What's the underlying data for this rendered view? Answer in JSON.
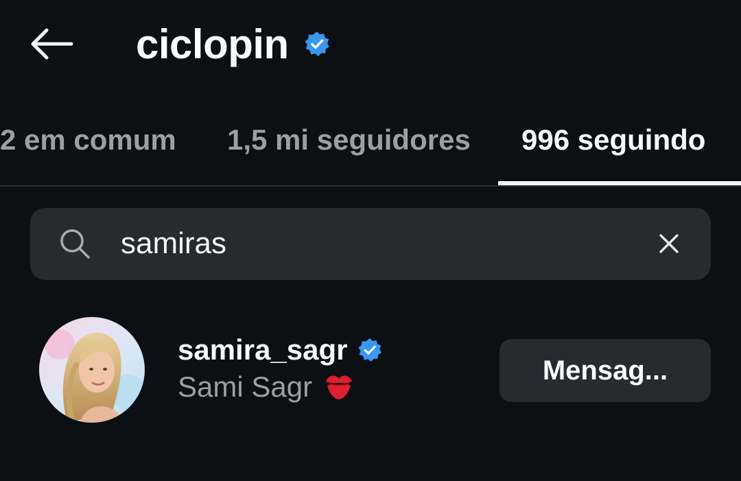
{
  "header": {
    "title": "ciclopin",
    "verified_icon": "verified-badge-icon",
    "back_icon": "arrow-left-icon"
  },
  "tabs": [
    {
      "label": "2 em comum",
      "active": false
    },
    {
      "label": "1,5 mi seguidores",
      "active": false
    },
    {
      "label": "996 seguindo",
      "active": true
    }
  ],
  "search": {
    "value": "samiras",
    "icon": "search-icon",
    "clear_icon": "close-icon"
  },
  "results": [
    {
      "username": "samira_sagr",
      "full_name": "Sami Sagr",
      "verified": true,
      "emoji": "kiss-mark-icon",
      "action_label": "Mensag..."
    }
  ],
  "colors": {
    "background": "#0c0f14",
    "surface": "#262a31",
    "verified": "#3897f0",
    "muted_text": "#9aa0a8",
    "kiss": "#e0202e"
  }
}
